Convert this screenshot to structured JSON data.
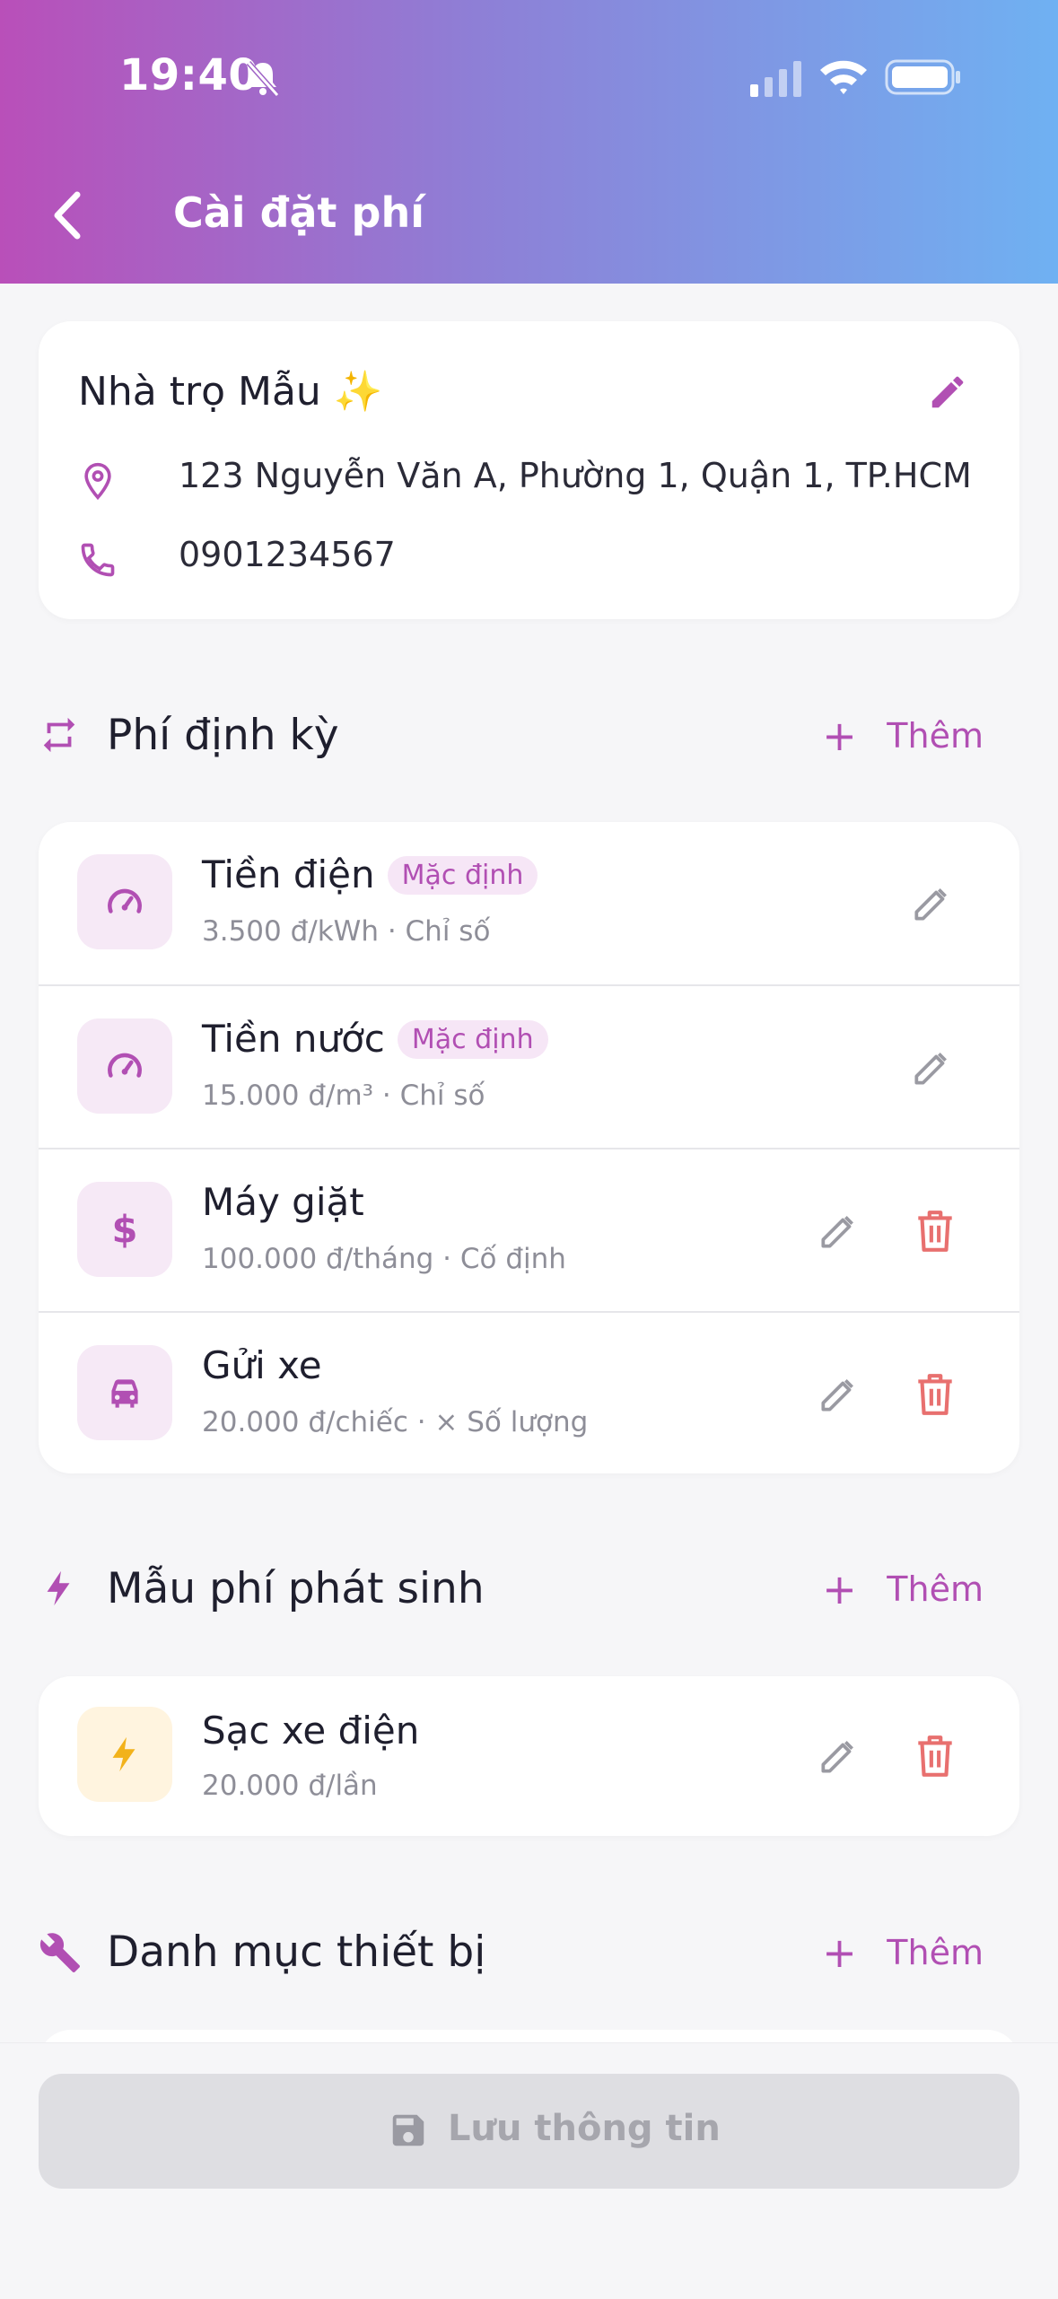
{
  "status_bar": {
    "time": "19:40"
  },
  "header": {
    "title": "Cài đặt phí"
  },
  "property": {
    "name": "Nhà trọ Mẫu ✨",
    "address": "123 Nguyễn Văn A, Phường 1, Quận 1, TP.HCM",
    "phone": "0901234567"
  },
  "recurring": {
    "title": "Phí định kỳ",
    "add_label": "Thêm",
    "items": [
      {
        "name": "Tiền điện",
        "badge": "Mặc định",
        "detail": "3.500 đ/kWh · Chỉ số",
        "icon": "gauge-icon"
      },
      {
        "name": "Tiền nước",
        "badge": "Mặc định",
        "detail": "15.000 đ/m³ · Chỉ số",
        "icon": "gauge-icon"
      },
      {
        "name": "Máy giặt",
        "detail": "100.000 đ/tháng · Cố định",
        "icon": "dollar-icon"
      },
      {
        "name": "Gửi xe",
        "detail": "20.000 đ/chiếc · × Số lượng",
        "icon": "car-icon"
      }
    ]
  },
  "incidental": {
    "title": "Mẫu phí phát sinh",
    "add_label": "Thêm",
    "items": [
      {
        "name": "Sạc xe điện",
        "detail": "20.000 đ/lần",
        "icon": "bolt-icon"
      }
    ]
  },
  "equipment": {
    "title": "Danh mục thiết bị",
    "add_label": "Thêm"
  },
  "footer": {
    "save_label": "Lưu thông tin"
  },
  "colors": {
    "accent": "#b14fb3",
    "delete": "#e8706f",
    "bolt": "#f2b21b"
  }
}
